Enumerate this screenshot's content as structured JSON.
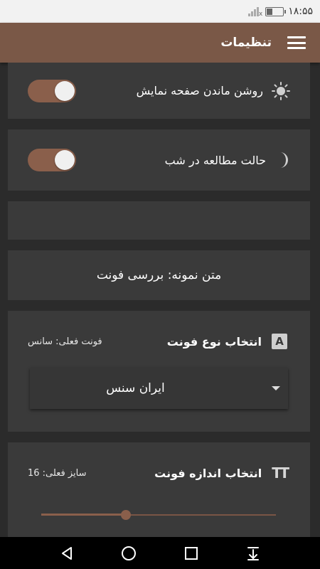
{
  "status_bar": {
    "time": "۱۸:۵۵",
    "battery_level": 0.35
  },
  "app_bar": {
    "title": "تنظیمات"
  },
  "settings": {
    "keep_screen_on": {
      "label": "روشن ماندن صفحه نمایش",
      "enabled": true
    },
    "night_mode": {
      "label": "حالت مطالعه در شب",
      "enabled": true
    }
  },
  "sample_text": "متن نمونه: بررسی فونت",
  "font_type": {
    "title": "انتخاب نوع فونت",
    "current": "فونت فعلی: سانس",
    "selected": "ایران سنس",
    "icon_letter": "A"
  },
  "font_size": {
    "title": "انتخاب اندازه فونت",
    "current": "سایز فعلی: 16",
    "slider_fraction": 0.36,
    "icon_letters": "TT"
  },
  "colors": {
    "app_bar": "#7a5847",
    "accent": "#8a5f4b",
    "background": "#2b2b2b",
    "card": "#3a3a3a"
  }
}
